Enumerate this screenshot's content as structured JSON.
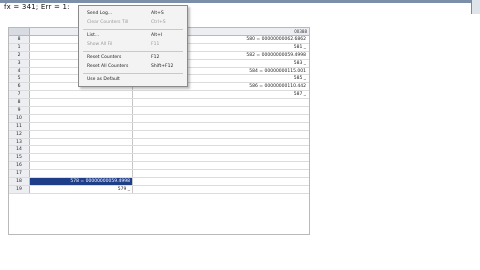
{
  "formula_bar": {
    "text": "fx = 341; Err = 1:"
  },
  "grid": {
    "header_right": "00388",
    "rows": [
      {
        "num": "8",
        "a": "",
        "b": "580 = 00000000062.6862"
      },
      {
        "num": "1",
        "a": "",
        "b": "581 _"
      },
      {
        "num": "2",
        "a": "",
        "b": "582 = 00000000059.4998"
      },
      {
        "num": "3",
        "a": "",
        "b": "583 _"
      },
      {
        "num": "4",
        "a": "",
        "b": "584 = 00000000115.001"
      },
      {
        "num": "5",
        "a": "",
        "b": "585 _"
      },
      {
        "num": "6",
        "a": "",
        "b": "586 = 00000000110.442"
      },
      {
        "num": "7",
        "a": "",
        "b": "587 _"
      },
      {
        "num": "8",
        "a": "",
        "b": ""
      },
      {
        "num": "9",
        "a": "",
        "b": ""
      },
      {
        "num": "10",
        "a": "",
        "b": ""
      },
      {
        "num": "11",
        "a": "",
        "b": ""
      },
      {
        "num": "12",
        "a": "",
        "b": ""
      },
      {
        "num": "13",
        "a": "",
        "b": ""
      },
      {
        "num": "14",
        "a": "",
        "b": ""
      },
      {
        "num": "15",
        "a": "",
        "b": ""
      },
      {
        "num": "16",
        "a": "",
        "b": ""
      },
      {
        "num": "17",
        "a": "",
        "b": ""
      },
      {
        "num": "18",
        "a": "578 = 00000000059.4998",
        "b": "",
        "selected": true
      },
      {
        "num": "19",
        "a": "579 _",
        "b": ""
      }
    ]
  },
  "context_menu": {
    "items": [
      {
        "label": "Send Log...",
        "shortcut": "Alt+S",
        "disabled": false
      },
      {
        "label": "Clear Counters Till",
        "shortcut": "Ctrl+S",
        "disabled": true
      },
      {
        "label": "List...",
        "shortcut": "Alt+I",
        "disabled": false
      },
      {
        "label": "Show All Fil",
        "shortcut": "F11",
        "disabled": true
      },
      {
        "label": "Reset Counters",
        "shortcut": "F12",
        "disabled": false
      },
      {
        "label": "Reset All Counters",
        "shortcut": "Shift+F12",
        "disabled": false
      },
      {
        "label": "Use as Default",
        "shortcut": "",
        "disabled": false
      }
    ]
  }
}
